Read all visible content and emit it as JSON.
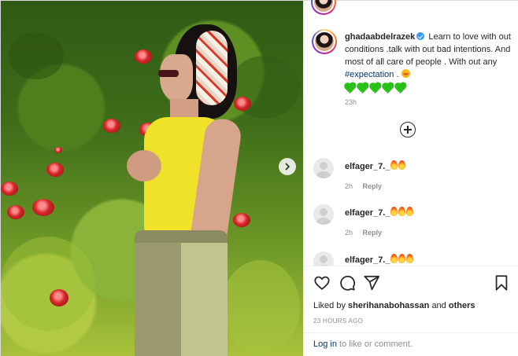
{
  "post": {
    "username": "ghadaabdelrazek",
    "caption_text": "Learn to love with out conditions .talk with out bad intentions. And most of all care of people . With out any",
    "hashtag": "#expectation",
    "caption_suffix": ".",
    "time_ago": "23h",
    "liked_by_prefix": "Liked by",
    "liked_by_user": "sherihanabohassan",
    "liked_by_suffix": "and",
    "liked_by_others": "others",
    "post_age": "23 HOURS AGO"
  },
  "comments": [
    {
      "username": "elfager_7._",
      "fires": 2,
      "time": "2h",
      "reply_label": "Reply"
    },
    {
      "username": "elfager_7._",
      "fires": 3,
      "time": "2h",
      "reply_label": "Reply"
    },
    {
      "username": "elfager_7._",
      "fires": 3,
      "time": "",
      "reply_label": ""
    }
  ],
  "footer": {
    "login_link": "Log in",
    "login_suffix": "to like or comment."
  },
  "icons": {
    "like": "heart-outline-icon",
    "comment": "comment-bubble-icon",
    "share": "paper-plane-icon",
    "save": "bookmark-icon",
    "load_more": "plus-circle-icon",
    "carousel": "chevron-right-icon"
  },
  "colors": {
    "link": "#00376b",
    "muted": "#8e8e8e",
    "verified": "#3897f0",
    "text": "#262626"
  }
}
